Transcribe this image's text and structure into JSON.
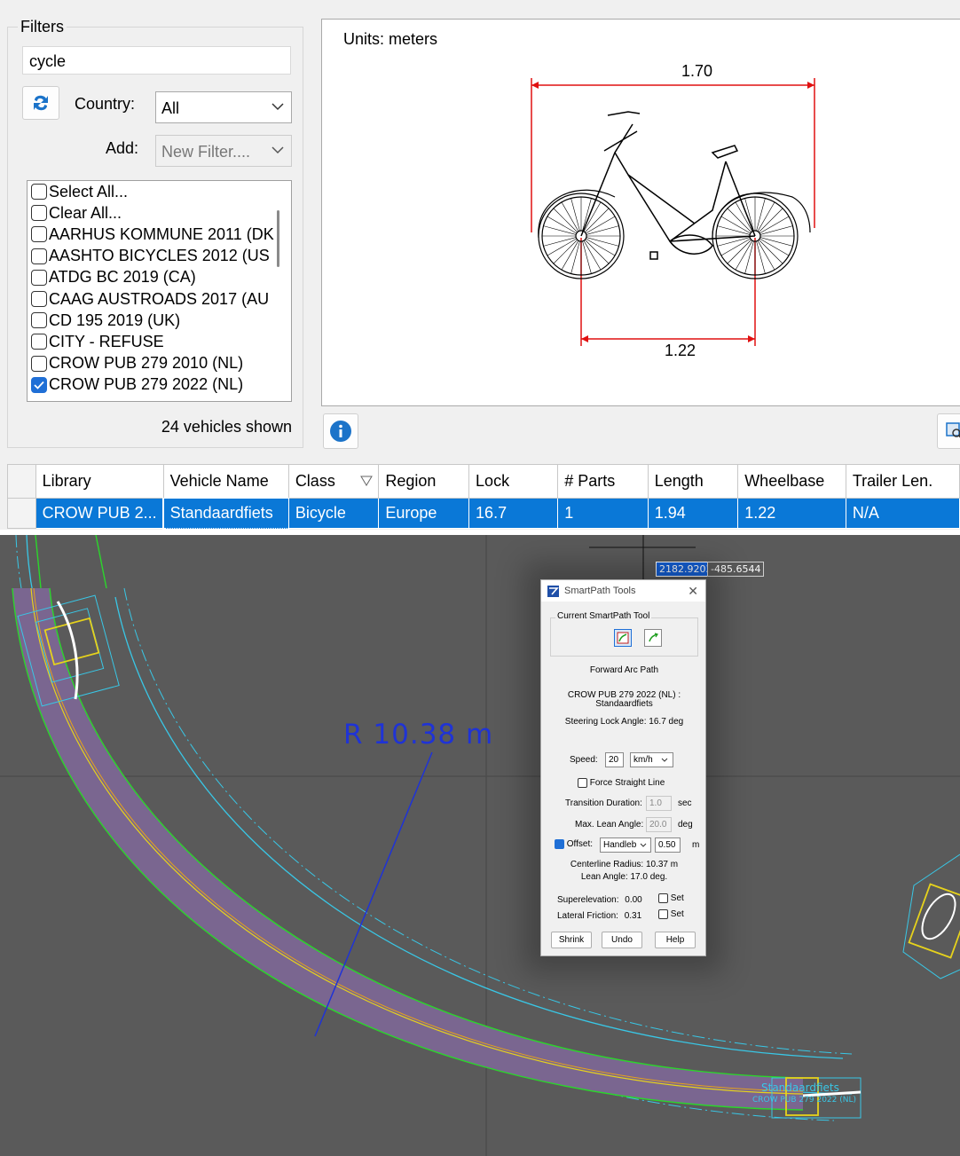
{
  "filters": {
    "title": "Filters",
    "search_value": "cycle",
    "country_label": "Country:",
    "country_value": "All",
    "add_label": "Add:",
    "add_placeholder": "New Filter....",
    "items": [
      {
        "label": "Select All...",
        "checked": false
      },
      {
        "label": "Clear All...",
        "checked": false
      },
      {
        "label": "AARHUS KOMMUNE 2011 (DK",
        "checked": false
      },
      {
        "label": "AASHTO BICYCLES 2012 (US",
        "checked": false
      },
      {
        "label": "ATDG BC 2019 (CA)",
        "checked": false
      },
      {
        "label": "CAAG AUSTROADS 2017 (AU",
        "checked": false
      },
      {
        "label": "CD 195 2019 (UK)",
        "checked": false
      },
      {
        "label": "CITY - REFUSE",
        "checked": false
      },
      {
        "label": "CROW PUB 279 2010 (NL)",
        "checked": false
      },
      {
        "label": "CROW PUB 279 2022 (NL)",
        "checked": true
      }
    ],
    "count_text": "24 vehicles shown"
  },
  "preview": {
    "units": "Units:  meters",
    "width_dim": "1.70",
    "wheelbase_dim": "1.22"
  },
  "table": {
    "headers": [
      "Library",
      "Vehicle Name",
      "Class",
      "Region",
      "Lock",
      "# Parts",
      "Length",
      "Wheelbase",
      "Trailer Len."
    ],
    "rows": [
      [
        "CROW PUB 2...",
        "Standaardfiets",
        "Bicycle",
        "Europe",
        "16.7",
        "1",
        "1.94",
        "1.22",
        "N/A"
      ]
    ]
  },
  "cad": {
    "coord_x": "2182.9203",
    "coord_y": "-485.6544",
    "radius_label": "R  10.38  m",
    "vehicle_label_1": "Standaardfiets",
    "vehicle_label_2": "CROW PUB 279 2022 (NL)"
  },
  "dialog": {
    "title": "SmartPath Tools",
    "group_label": "Current SmartPath Tool",
    "path_name": "Forward Arc Path",
    "vehicle_line1": "CROW PUB 279 2022 (NL) :",
    "vehicle_line2": "Standaardfiets",
    "steering": "Steering Lock Angle: 16.7 deg",
    "speed_label": "Speed:",
    "speed_value": "20",
    "speed_unit": "km/h",
    "force_straight": "Force Straight Line",
    "transition_label": "Transition Duration:",
    "transition_value": "1.0",
    "transition_unit": "sec",
    "lean_label": "Max. Lean Angle:",
    "lean_value": "20.0",
    "lean_unit": "deg",
    "offset_label": "Offset:",
    "offset_type": "Handleb",
    "offset_value": "0.50",
    "offset_unit": "m",
    "centerline": "Centerline Radius: 10.37 m",
    "lean_angle": "Lean Angle: 17.0 deg.",
    "superelev_label": "Superelevation:",
    "superelev_value": "0.00",
    "friction_label": "Lateral Friction:",
    "friction_value": "0.31",
    "set_label": "Set",
    "btn_shrink": "Shrink",
    "btn_undo": "Undo",
    "btn_help": "Help"
  },
  "colors": {
    "selection": "#0a78d7",
    "path_fill": "#7a6690",
    "cyan": "#39c7e6",
    "green": "#2bd62b",
    "yellow": "#e6d21c",
    "dim_red": "#e01010"
  }
}
